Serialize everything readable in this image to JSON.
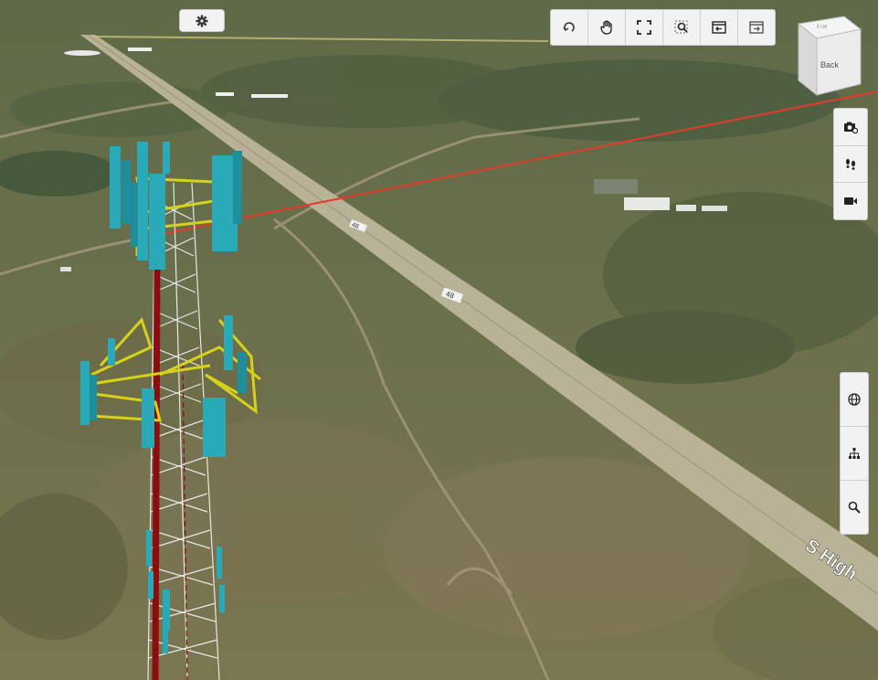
{
  "scene": {
    "description_none": "",
    "road_labels": [
      "S High"
    ],
    "route_shields": [
      "48",
      "48",
      "48"
    ]
  },
  "toolbar": {
    "items": [
      {
        "name": "orbit",
        "icon": "orbit-icon"
      },
      {
        "name": "pan",
        "icon": "hand-icon"
      },
      {
        "name": "fit-view",
        "icon": "fit-view-icon"
      },
      {
        "name": "zoom-window",
        "icon": "zoom-window-icon"
      },
      {
        "name": "previous-view",
        "icon": "previous-view-icon"
      },
      {
        "name": "next-view",
        "icon": "next-view-icon"
      }
    ]
  },
  "nav_cube": {
    "face_label": "Back",
    "top_label": "ʇ∩ᴎ"
  },
  "right_tools_top": [
    {
      "name": "screenshot",
      "icon": "camera-settings-icon"
    },
    {
      "name": "walk",
      "icon": "footprints-icon"
    },
    {
      "name": "record",
      "icon": "video-camera-icon"
    }
  ],
  "right_tools_bottom": [
    {
      "name": "globe",
      "icon": "globe-icon"
    },
    {
      "name": "hierarchy",
      "icon": "hierarchy-icon"
    },
    {
      "name": "search",
      "icon": "search-icon"
    }
  ],
  "colors": {
    "panel": "#f2f2f2",
    "antenna": "#2aaab8",
    "mount": "#d6d21a",
    "sightline": "#e53b2a",
    "feeder": "#8b0d0d"
  }
}
